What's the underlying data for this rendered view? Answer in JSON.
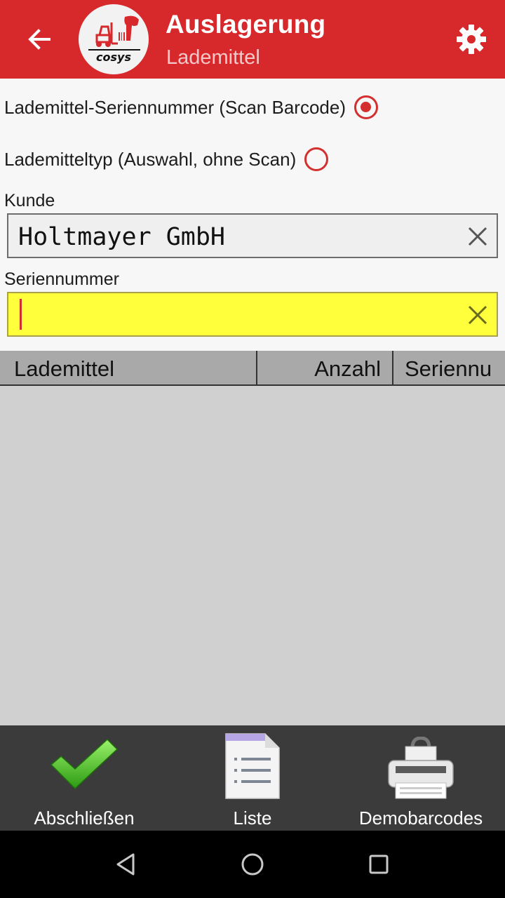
{
  "appbar": {
    "title": "Auslagerung",
    "subtitle": "Lademittel",
    "background": "#d7282b",
    "icons": {
      "back": "arrow-left-icon",
      "logo": "cosys-forklift-logo",
      "settings": "gear-icon"
    }
  },
  "options": [
    {
      "label": "Lademittel-Seriennummer (Scan Barcode)",
      "selected": true
    },
    {
      "label": "Lademitteltyp (Auswahl, ohne Scan)",
      "selected": false
    }
  ],
  "fields": {
    "customer": {
      "label": "Kunde",
      "value": "Holtmayer GmbH"
    },
    "serial": {
      "label": "Seriennummer",
      "value": "",
      "highlight": "#ffff3c"
    }
  },
  "table": {
    "columns": [
      "Lademittel",
      "Anzahl",
      "Seriennu"
    ],
    "rows": []
  },
  "actions": [
    {
      "label": "Abschließen",
      "icon": "checkmark-icon"
    },
    {
      "label": "Liste",
      "icon": "document-list-icon"
    },
    {
      "label": "Demobarcodes",
      "icon": "printer-icon"
    }
  ],
  "system_nav": {
    "icons": [
      "back-triangle-icon",
      "home-circle-icon",
      "recents-square-icon"
    ]
  }
}
